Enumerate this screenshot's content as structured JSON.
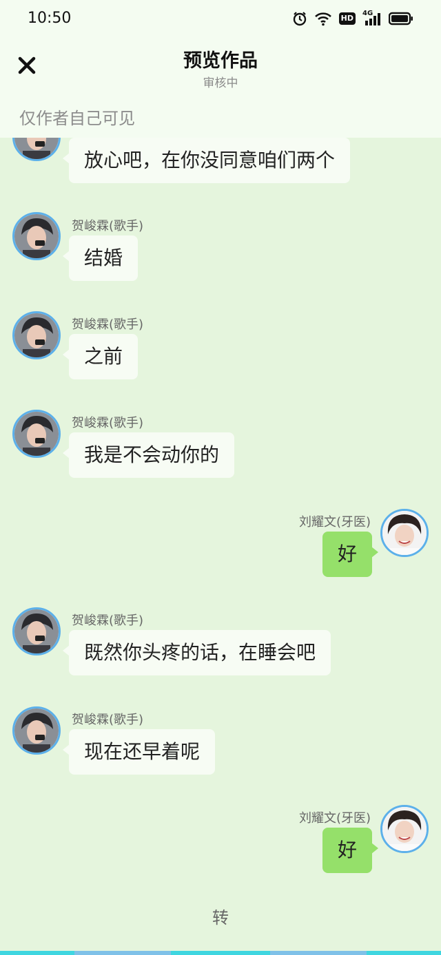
{
  "status_bar": {
    "time": "10:50",
    "icons": [
      "alarm-icon",
      "wifi-icon",
      "hd-icon",
      "signal-4g-icon",
      "battery-icon"
    ],
    "network_label": "4G",
    "hd_label": "HD"
  },
  "header": {
    "title": "预览作品",
    "subtitle": "审核中",
    "visibility_note": "仅作者自己可见",
    "close_icon": "close-icon"
  },
  "messages": [
    {
      "side": "left",
      "sender": "",
      "text": "放心吧，在你没同意咱们两个"
    },
    {
      "side": "left",
      "sender": "贺峻霖(歌手)",
      "text": "结婚"
    },
    {
      "side": "left",
      "sender": "贺峻霖(歌手)",
      "text": "之前"
    },
    {
      "side": "left",
      "sender": "贺峻霖(歌手)",
      "text": "我是不会动你的"
    },
    {
      "side": "right",
      "sender": "刘耀文(牙医)",
      "text": "好"
    },
    {
      "side": "left",
      "sender": "贺峻霖(歌手)",
      "text": "既然你头疼的话，在睡会吧"
    },
    {
      "side": "left",
      "sender": "贺峻霖(歌手)",
      "text": "现在还早着呢"
    },
    {
      "side": "right",
      "sender": "刘耀文(牙医)",
      "text": "好"
    }
  ],
  "footer": {
    "label": "转"
  },
  "colors": {
    "background": "#e5f5dd",
    "header_background": "#f4fcf1",
    "left_bubble": "#f7fcf4",
    "right_bubble": "#95e06a",
    "avatar_ring": "#5cb0ea",
    "bottom_bar": "#3fd6e0"
  }
}
